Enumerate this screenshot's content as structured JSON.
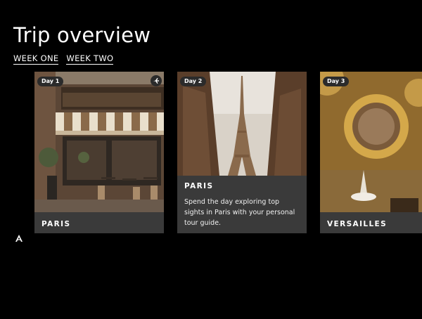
{
  "page": {
    "title": "Trip overview"
  },
  "tabs": [
    {
      "label": "WEEK ONE"
    },
    {
      "label": "WEEK TWO"
    }
  ],
  "cards": [
    {
      "day": "Day 1",
      "title": "PARIS",
      "icon": "plane-icon"
    },
    {
      "day": "Day 2",
      "title": "PARIS",
      "description": "Spend the day exploring top sights in Paris with your personal tour guide."
    },
    {
      "day": "Day 3",
      "title": "VERSAILLES"
    }
  ],
  "colors": {
    "background": "#000000",
    "card_footer": "#3a3a3a",
    "badge": "#2b2b2b"
  },
  "logo": {
    "icon": "brand-logo-icon"
  }
}
